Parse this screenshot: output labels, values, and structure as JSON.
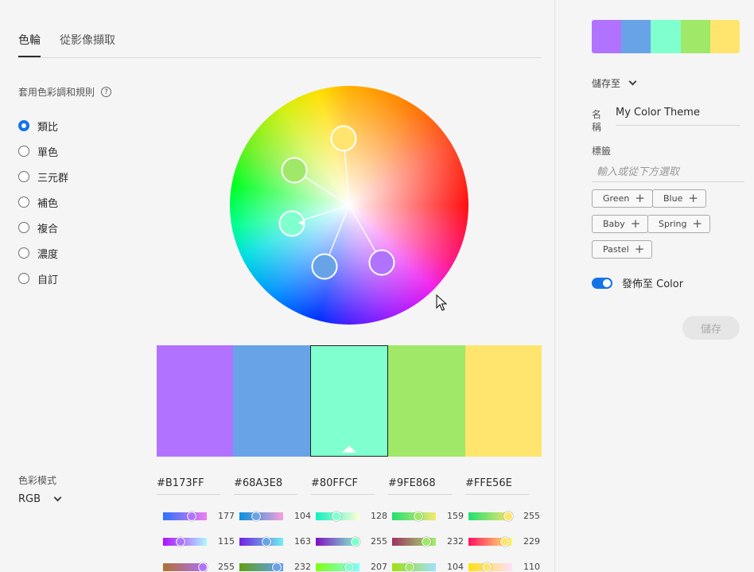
{
  "tabs": [
    {
      "label": "色輪",
      "active": true
    },
    {
      "label": "從影像擷取",
      "active": false
    }
  ],
  "harmony": {
    "title": "套用色彩調和規則",
    "help_icon": "?",
    "rules": [
      {
        "label": "類比",
        "selected": true
      },
      {
        "label": "單色",
        "selected": false
      },
      {
        "label": "三元群",
        "selected": false
      },
      {
        "label": "補色",
        "selected": false
      },
      {
        "label": "複合",
        "selected": false
      },
      {
        "label": "濃度",
        "selected": false
      },
      {
        "label": "自訂",
        "selected": false
      }
    ]
  },
  "colors": [
    {
      "hex": "#B173FF",
      "swatch": "#b173ff"
    },
    {
      "hex": "#68A3E8",
      "swatch": "#68a3e8"
    },
    {
      "hex": "#80FFCF",
      "swatch": "#80ffcf",
      "selected": true
    },
    {
      "hex": "#9FE868",
      "swatch": "#9fe868"
    },
    {
      "hex": "#FFE56E",
      "swatch": "#ffe56e"
    }
  ],
  "color_mode": {
    "label": "色彩模式",
    "value": "RGB"
  },
  "sliders": [
    {
      "values": [
        "177",
        "104",
        "128",
        "159",
        "255"
      ]
    },
    {
      "values": [
        "115",
        "163",
        "255",
        "232",
        "229"
      ]
    },
    {
      "values": [
        "255",
        "232",
        "207",
        "104",
        "110"
      ]
    }
  ],
  "right_panel": {
    "save_to_label": "儲存至",
    "name_label": "名稱",
    "name_value": "My Color Theme",
    "tags_label": "標籤",
    "tags_placeholder": "輸入或從下方選取",
    "tags": [
      "Green",
      "Blue",
      "Baby",
      "Spring",
      "Pastel"
    ],
    "publish_label": "發佈至 Color",
    "publish_on": true,
    "save_button": "儲存"
  }
}
